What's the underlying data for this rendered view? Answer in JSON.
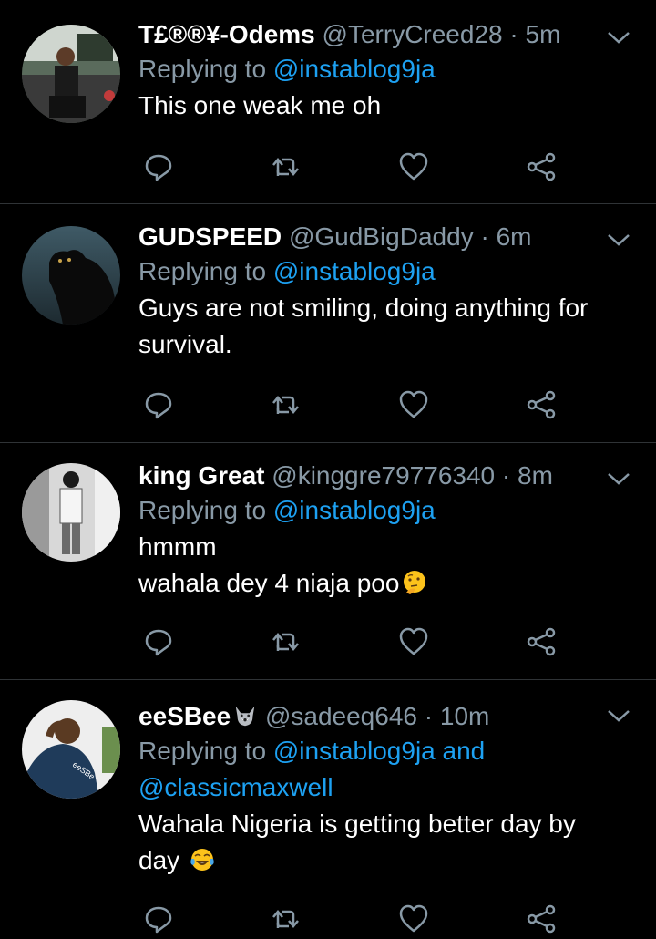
{
  "tweets": [
    {
      "name": "T£®®¥-Odems",
      "handle": "@TerryCreed28",
      "sep": "·",
      "time": "5m",
      "replying_prefix": "Replying to",
      "replying_mentions": [
        "@instablog9ja"
      ],
      "text_lines": [
        "This one weak me oh"
      ]
    },
    {
      "name": "GUDSPEED",
      "handle": "@GudBigDaddy",
      "sep": "·",
      "time": "6m",
      "replying_prefix": "Replying to",
      "replying_mentions": [
        "@instablog9ja"
      ],
      "text_lines": [
        "Guys are not smiling, doing anything for",
        "survival."
      ]
    },
    {
      "name": "king Great",
      "handle": "@kinggre79776340",
      "sep": "·",
      "time": "8m",
      "replying_prefix": "Replying to",
      "replying_mentions": [
        "@instablog9ja"
      ],
      "text_lines": [
        "hmmm",
        "wahala dey 4 niaja poo"
      ],
      "emoji": "thinking-face-emoji"
    },
    {
      "name": "eeSBee",
      "name_emoji": "wolf-face-emoji",
      "handle": "@sadeeq646",
      "sep": "·",
      "time": "10m",
      "replying_prefix": "Replying to",
      "replying_mentions": [
        "@instablog9ja and",
        "@classicmaxwell"
      ],
      "text_lines": [
        "Wahala Nigeria is getting better day by",
        "day"
      ],
      "emoji": "tears-of-joy-emoji"
    }
  ],
  "icons": {
    "reply": "reply-icon",
    "retweet": "retweet-icon",
    "like": "like-icon",
    "share": "share-icon",
    "menu": "chevron-down-icon"
  },
  "colors": {
    "background": "#000000",
    "text": "#ffffff",
    "muted": "#8899a6",
    "mention": "#1da1f2",
    "divider": "#2f3336"
  }
}
